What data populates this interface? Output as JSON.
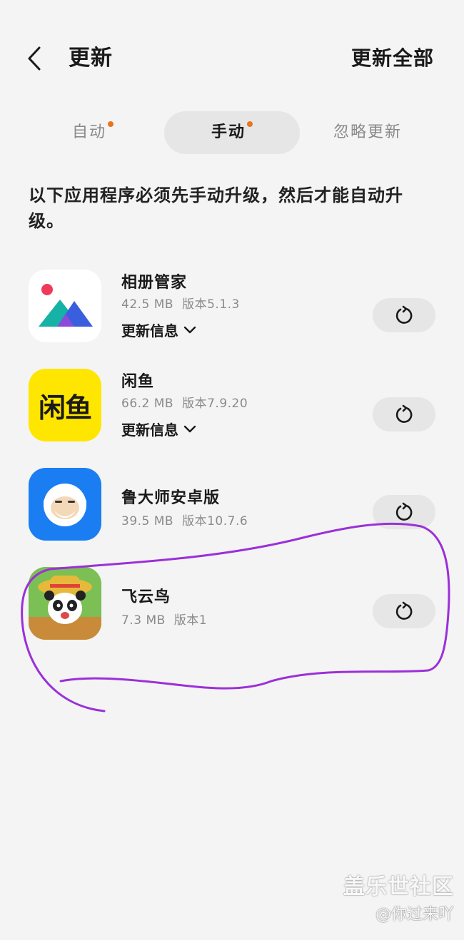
{
  "header": {
    "title": "更新",
    "update_all_label": "更新全部",
    "back_icon": "chevron-left-icon"
  },
  "tabs": [
    {
      "label": "自动",
      "has_dot": true,
      "active": false
    },
    {
      "label": "手动",
      "has_dot": true,
      "active": true
    },
    {
      "label": "忽略更新",
      "has_dot": false,
      "active": false
    }
  ],
  "description": "以下应用程序必须先手动升级，然后才能自动升级。",
  "apps": [
    {
      "name": "相册管家",
      "size": "42.5 MB",
      "version": "版本5.1.3",
      "info_label": "更新信息",
      "icon": "gallery-app-icon",
      "update_icon": "refresh-icon"
    },
    {
      "name": "闲鱼",
      "size": "66.2 MB",
      "version": "版本7.9.20",
      "info_label": "更新信息",
      "icon": "xianyu-app-icon",
      "update_icon": "refresh-icon"
    },
    {
      "name": "鲁大师安卓版",
      "size": "39.5 MB",
      "version": "版本10.7.6",
      "info_label": "",
      "icon": "ludashi-app-icon",
      "update_icon": "refresh-icon"
    },
    {
      "name": "飞云鸟",
      "size": "7.3 MB",
      "version": "版本1",
      "info_label": "",
      "icon": "panda-game-app-icon",
      "update_icon": "refresh-icon"
    }
  ],
  "icon_texts": {
    "xianyu": "闲鱼"
  },
  "watermark": {
    "brand": "盖乐世社区",
    "user": "@你过来吖"
  },
  "colors": {
    "background": "#f4f4f4",
    "accent_dot": "#e8751f",
    "pill": "#e6e6e6",
    "annotation": "#9b30d9"
  }
}
